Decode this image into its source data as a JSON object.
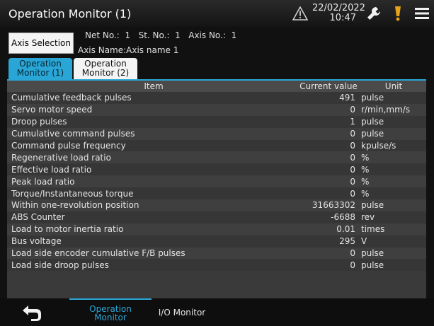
{
  "header": {
    "title": "Operation Monitor (1)",
    "date": "22/02/2022",
    "time": "10:47"
  },
  "axis": {
    "selection_label": "Axis Selection",
    "net_no_label": "Net No.:",
    "net_no": "1",
    "st_no_label": "St. No.:",
    "st_no": "1",
    "axis_no_label": "Axis No.:",
    "axis_no": "1",
    "axis_name_label": "Axis Name:",
    "axis_name": "Axis name 1"
  },
  "tabs": [
    {
      "line1": "Operation",
      "line2": "Monitor (1)"
    },
    {
      "line1": "Operation",
      "line2": "Monitor (2)"
    }
  ],
  "table": {
    "headers": {
      "item": "Item",
      "value": "Current value",
      "unit": "Unit"
    },
    "rows": [
      {
        "item": "Cumulative feedback pulses",
        "value": "491",
        "unit": "pulse"
      },
      {
        "item": "Servo motor speed",
        "value": "0",
        "unit": "r/min,mm/s"
      },
      {
        "item": "Droop pulses",
        "value": "1",
        "unit": "pulse"
      },
      {
        "item": "Cumulative command pulses",
        "value": "0",
        "unit": "pulse"
      },
      {
        "item": "Command pulse frequency",
        "value": "0",
        "unit": "kpulse/s"
      },
      {
        "item": "Regenerative load ratio",
        "value": "0",
        "unit": "%"
      },
      {
        "item": "Effective load ratio",
        "value": "0",
        "unit": "%"
      },
      {
        "item": "Peak load ratio",
        "value": "0",
        "unit": "%"
      },
      {
        "item": "Torque/Instantaneous torque",
        "value": "0",
        "unit": "%"
      },
      {
        "item": "Within one-revolution position",
        "value": "31663302",
        "unit": "pulse"
      },
      {
        "item": "ABS Counter",
        "value": "-6688",
        "unit": "rev"
      },
      {
        "item": "Load to motor inertia ratio",
        "value": "0.01",
        "unit": "times"
      },
      {
        "item": "Bus voltage",
        "value": "295",
        "unit": "V"
      },
      {
        "item": "Load side encoder cumulative F/B pulses",
        "value": "0",
        "unit": "pulse"
      },
      {
        "item": "Load side droop pulses",
        "value": "0",
        "unit": "pulse"
      }
    ]
  },
  "footer": {
    "tab1_line1": "Operation",
    "tab1_line2": "Monitor",
    "tab2": "I/O Monitor"
  },
  "colors": {
    "accent": "#2aa6d6",
    "warning": "#e8a21a"
  }
}
